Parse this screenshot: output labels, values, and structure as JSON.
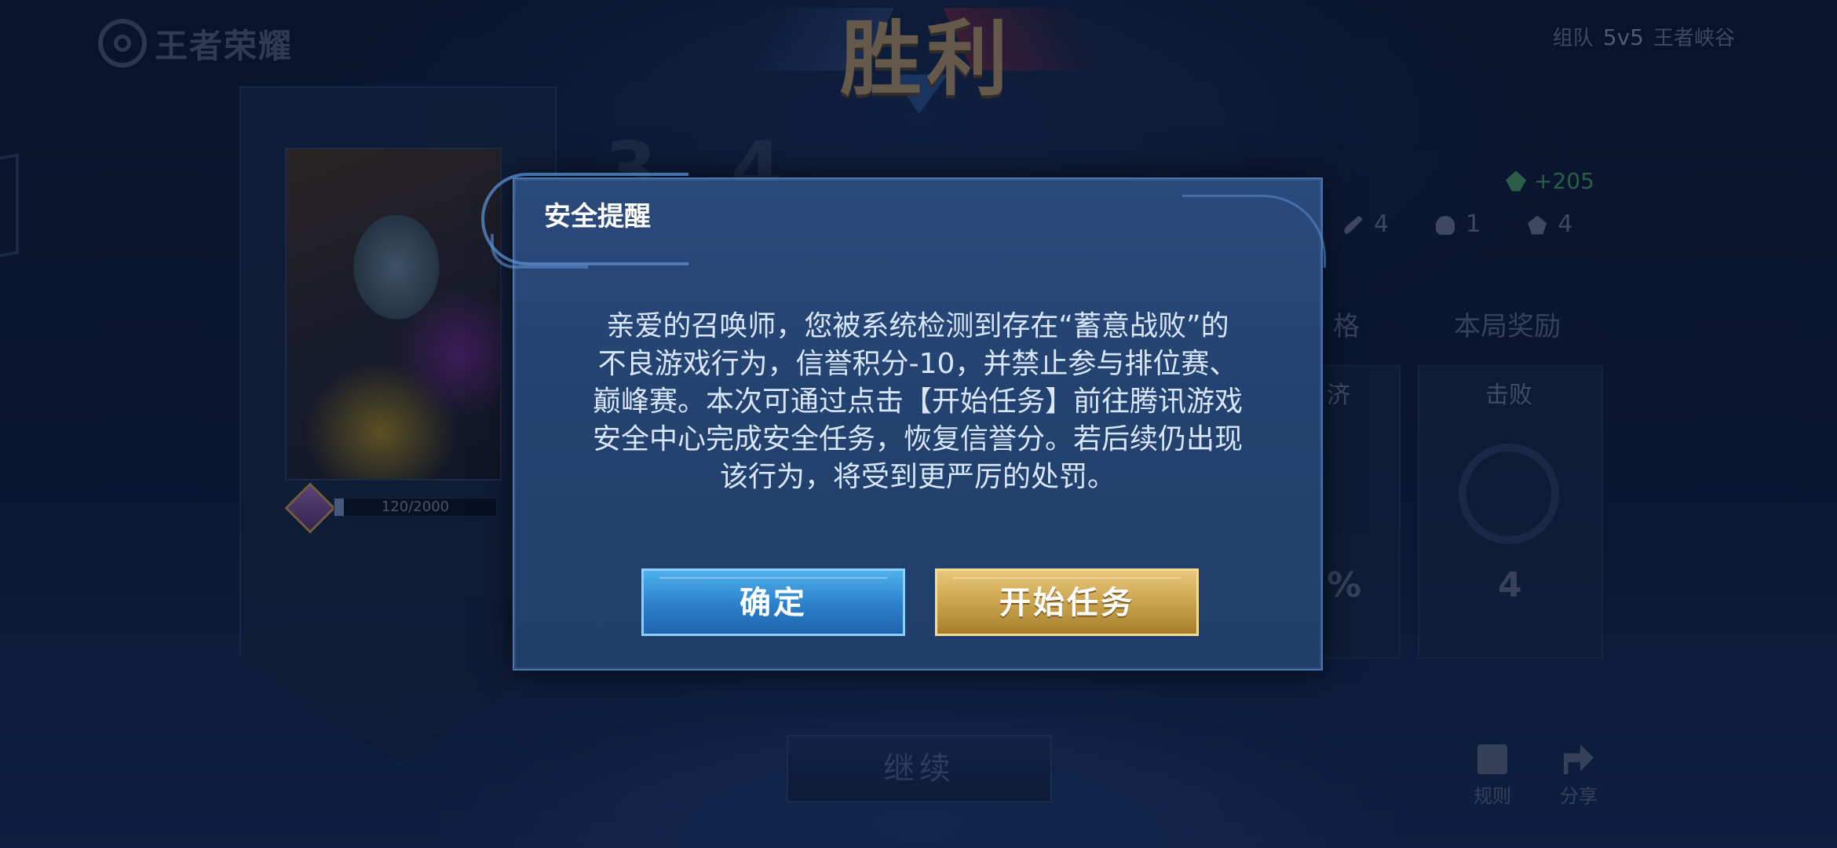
{
  "header": {
    "game_logo": "王者荣耀",
    "victory_title": "胜利",
    "team_label": "组队",
    "mode": "5v5",
    "map": "王者峡谷"
  },
  "player": {
    "rank_progress": "120/2000",
    "rank_progress_fraction": 0.06,
    "score_partial": "3 4"
  },
  "stats": {
    "gold": "+205",
    "kills": "4",
    "deaths": "1",
    "assists": "4"
  },
  "tabs": {
    "tab_partial": "格",
    "rewards": "本局奖励"
  },
  "cards": {
    "economy_title_partial": "济",
    "economy_value_partial": "%",
    "defeat_title": "击败",
    "defeat_value": "4"
  },
  "continue_label": "继续",
  "tools": {
    "rules": "规则",
    "share": "分享"
  },
  "modal": {
    "title": "安全提醒",
    "message": "亲爱的召唤师，您被系统检测到存在“蓄意战败”的\n不良游戏行为，信誉积分-10，并禁止参与排位赛、\n巅峰赛。本次可通过点击【开始任务】前往腾讯游戏\n安全中心完成安全任务，恢复信誉分。若后续仍出现\n该行为，将受到更严厉的处罚。",
    "confirm_label": "确定",
    "start_task_label": "开始任务"
  },
  "colors": {
    "modal_bg": "#24426f",
    "confirm_blue": "#2b7fc9",
    "task_gold": "#c9a04a",
    "gold_green": "#4ea36a"
  }
}
